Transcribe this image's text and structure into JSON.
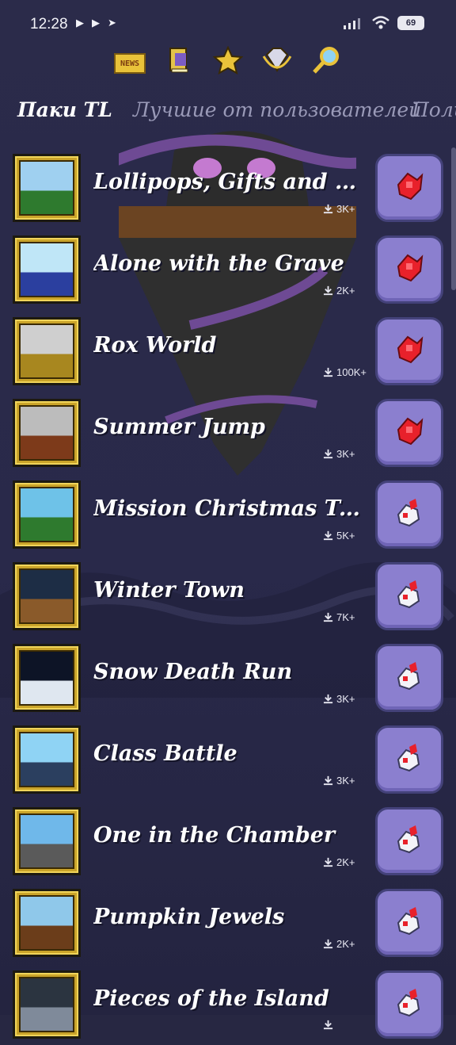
{
  "status_bar": {
    "time": "12:28",
    "battery": "69"
  },
  "top_icons": [
    {
      "name": "news",
      "label": "NEWS"
    },
    {
      "name": "book",
      "label": ""
    },
    {
      "name": "star",
      "label": ""
    },
    {
      "name": "gem",
      "label": ""
    },
    {
      "name": "magnifier",
      "label": ""
    }
  ],
  "tabs": [
    {
      "label": "Паки TL",
      "active": true
    },
    {
      "label": "Лучшие от пользователей",
      "active": false
    },
    {
      "label": "Поль",
      "active": false
    }
  ],
  "packs": [
    {
      "title": "Lollipops, Gifts and Sa...",
      "downloads": "3K+",
      "icon": "red-gift-icon",
      "thumb": "christmas-tree"
    },
    {
      "title": "Alone with the Grave",
      "downloads": "2K+",
      "icon": "red-gift-icon",
      "thumb": "ice-grave"
    },
    {
      "title": "Rox World",
      "downloads": "100K+",
      "icon": "red-gift-icon",
      "thumb": "chest"
    },
    {
      "title": "Summer Jump",
      "downloads": "3K+",
      "icon": "red-gift-icon",
      "thumb": "sword"
    },
    {
      "title": "Mission Christmas Tree",
      "downloads": "5K+",
      "icon": "gift-bag-icon",
      "thumb": "christmas-tree-2"
    },
    {
      "title": "Winter Town",
      "downloads": "7K+",
      "icon": "gift-bag-icon",
      "thumb": "winter-town"
    },
    {
      "title": "Snow Death Run",
      "downloads": "3K+",
      "icon": "gift-bag-icon",
      "thumb": "snow-night"
    },
    {
      "title": "Class Battle",
      "downloads": "3K+",
      "icon": "gift-bag-icon",
      "thumb": "boat"
    },
    {
      "title": "One in the Chamber",
      "downloads": "2K+",
      "icon": "gift-bag-icon",
      "thumb": "stone"
    },
    {
      "title": "Pumpkin Jewels",
      "downloads": "2K+",
      "icon": "gift-bag-icon",
      "thumb": "pumpkin"
    },
    {
      "title": "Pieces of the Island",
      "downloads": "",
      "icon": "gift-bag-icon",
      "thumb": "island"
    }
  ]
}
